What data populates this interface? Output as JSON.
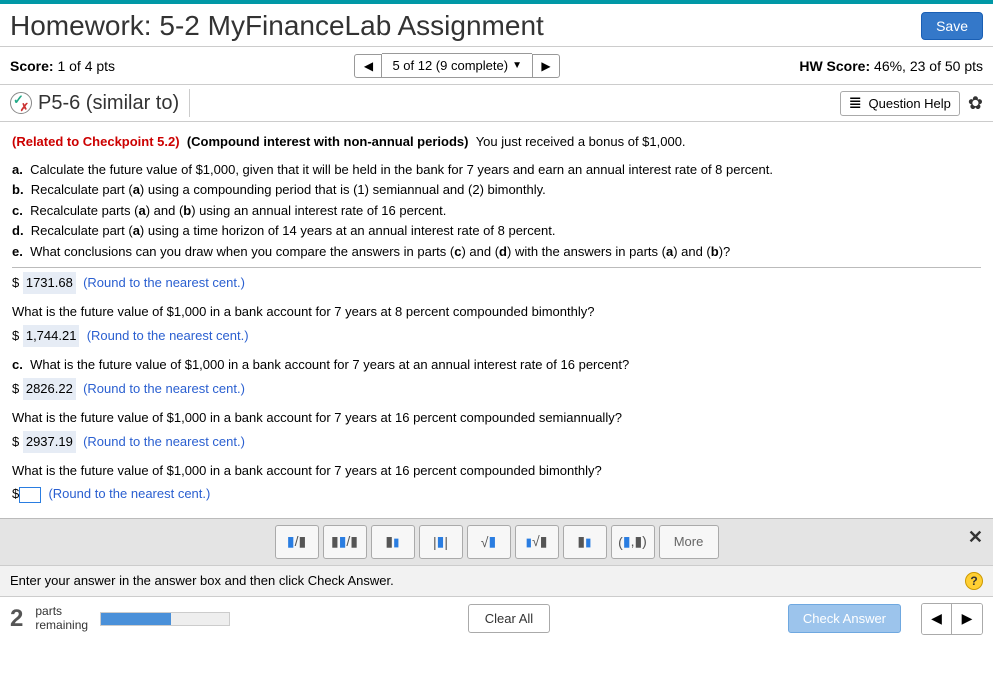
{
  "header": {
    "title": "Homework: 5-2 MyFinanceLab Assignment",
    "save": "Save"
  },
  "scorebar": {
    "score_label": "Score:",
    "score_value": "1 of 4 pts",
    "nav_text": "5 of 12 (9 complete)",
    "hw_label": "HW Score:",
    "hw_value": "46%, 23 of 50 pts"
  },
  "qbar": {
    "qtitle": "P5-6 (similar to)",
    "help": "Question Help"
  },
  "content": {
    "related": "(Related to Checkpoint 5.2)",
    "topic": "(Compound interest with non-annual periods)",
    "intro": "You just received a bonus of $1,000.",
    "a_text": "Calculate the future value of $1,000, given that it will be held in the bank for 7 years and earn an annual interest rate of 8 percent.",
    "b_text": "Recalculate part (a) using a compounding period that is (1) semiannual and (2) bimonthly.",
    "c_text": "Recalculate parts (a) and (b) using an annual interest rate of 16 percent.",
    "d_text": "Recalculate part (a) using a time horizon of 14 years at an annual interest rate of 8 percent.",
    "e_text": "What conclusions can you draw when you compare the answers in parts (c) and (d) with the answers in parts (a) and (b)?",
    "ans1_val": "1731.68",
    "round": "(Round to the nearest cent.)",
    "q2": "What is the future value of $1,000 in a bank account for 7 years at 8 percent compounded bimonthly?",
    "ans2_val": "1,744.21",
    "q3_letter": "c.",
    "q3": "What is the future value of $1,000 in a bank account for 7 years at an annual interest rate of 16 percent?",
    "ans3_val": "2826.22",
    "q4": "What is the future value of $1,000 in a bank account for 7 years at 16 percent compounded semiannually?",
    "ans4_val": "2937.19",
    "q5": "What is the future value of $1,000 in a bank account for 7 years at 16 percent compounded bimonthly?"
  },
  "toolbar": {
    "more": "More"
  },
  "instr": {
    "text": "Enter your answer in the answer box and then click Check Answer."
  },
  "footer": {
    "parts_num": "2",
    "parts_label1": "parts",
    "parts_label2": "remaining",
    "clear": "Clear All",
    "check": "Check Answer"
  }
}
